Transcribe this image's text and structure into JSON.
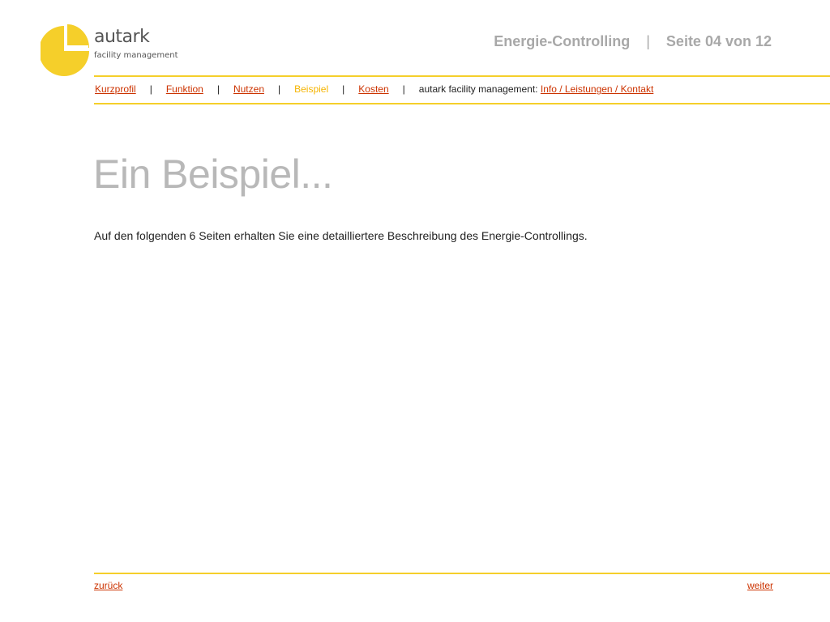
{
  "logo": {
    "name": "autark",
    "subtitle": "facility management"
  },
  "header": {
    "title": "Energie-Controlling",
    "separator": "|",
    "page_indicator": "Seite 04 von 12"
  },
  "nav": {
    "items": [
      {
        "label": "Kurzprofil",
        "active": false
      },
      {
        "label": "Funktion",
        "active": false
      },
      {
        "label": "Nutzen",
        "active": false
      },
      {
        "label": "Beispiel",
        "active": true
      },
      {
        "label": "Kosten",
        "active": false
      }
    ],
    "separator": "|",
    "company_label": "autark facility management:",
    "company_link": "Info / Leistungen / Kontakt"
  },
  "main": {
    "title": "Ein Beispiel...",
    "intro": "Auf den folgenden 6 Seiten erhalten Sie eine detailliertere Beschreibung des Energie-Controllings."
  },
  "footer": {
    "back_label": "zurück",
    "next_label": "weiter"
  },
  "colors": {
    "accent_yellow": "#f5cf2a",
    "link_red": "#cc3300",
    "active_nav": "#f5b400",
    "heading_gray": "#b8b8b8"
  }
}
